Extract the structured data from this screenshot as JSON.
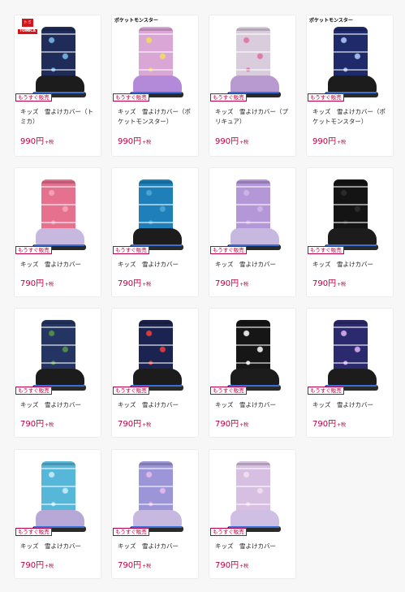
{
  "badge_label": "もうすぐ販売",
  "tax_suffix": "+税",
  "products": [
    {
      "name": "キッズ　雪よけカバー（トミカ）",
      "price": "990円",
      "color": "#1f2c5a",
      "pattern": "#6fa8dc",
      "brand": "トミカ / TOMICA",
      "boot": "#1c1c1c"
    },
    {
      "name": "キッズ　雪よけカバー（ポケットモンスター）",
      "price": "990円",
      "color": "#d9a6d6",
      "pattern": "#f2d66b",
      "brand": "ポケットモンスター",
      "boot": "#b28ad9"
    },
    {
      "name": "キッズ　雪よけカバー（プリキュア）",
      "price": "990円",
      "color": "#d9ccdc",
      "pattern": "#e07aa8",
      "brand": "",
      "boot": "#b89ad0"
    },
    {
      "name": "キッズ　雪よけカバー（ポケットモンスター）",
      "price": "990円",
      "color": "#1f2a6b",
      "pattern": "#9fb7e8",
      "brand": "ポケットモンスター",
      "boot": "#1c1c1c"
    },
    {
      "name": "キッズ　雪よけカバー",
      "price": "790円",
      "color": "#e5718f",
      "pattern": "#f4a0b4",
      "brand": "",
      "boot": "#c7b8e0"
    },
    {
      "name": "キッズ　雪よけカバー",
      "price": "790円",
      "color": "#1f7fb8",
      "pattern": "#4aa3d4",
      "brand": "",
      "boot": "#1c1c1c"
    },
    {
      "name": "キッズ　雪よけカバー",
      "price": "790円",
      "color": "#b497d6",
      "pattern": "#cbb3e6",
      "brand": "",
      "boot": "#c7b8e0"
    },
    {
      "name": "キッズ　雪よけカバー",
      "price": "790円",
      "color": "#141414",
      "pattern": "#2b2b2b",
      "brand": "",
      "boot": "#1c1c1c"
    },
    {
      "name": "キッズ　雪よけカバー",
      "price": "790円",
      "color": "#243563",
      "pattern": "#4f8a46",
      "brand": "",
      "boot": "#1c1c1c"
    },
    {
      "name": "キッズ　雪よけカバー",
      "price": "790円",
      "color": "#1b2450",
      "pattern": "#d83a3a",
      "brand": "",
      "boot": "#1c1c1c"
    },
    {
      "name": "キッズ　雪よけカバー",
      "price": "790円",
      "color": "#161616",
      "pattern": "#e0e0e0",
      "brand": "",
      "boot": "#1c1c1c"
    },
    {
      "name": "キッズ　雪よけカバー",
      "price": "790円",
      "color": "#2b2a6e",
      "pattern": "#c9a0e0",
      "brand": "",
      "boot": "#1c1c1c"
    },
    {
      "name": "キッズ　雪よけカバー",
      "price": "790円",
      "color": "#56b7d8",
      "pattern": "#bfe6f2",
      "brand": "",
      "boot": "#b8a8d8"
    },
    {
      "name": "キッズ　雪よけカバー",
      "price": "790円",
      "color": "#9c96d8",
      "pattern": "#e0b8e8",
      "brand": "",
      "boot": "#c7b8e0"
    },
    {
      "name": "キッズ　雪よけカバー",
      "price": "790円",
      "color": "#d6bfe0",
      "pattern": "#eedcf0",
      "brand": "",
      "boot": "#d0bfe4"
    }
  ],
  "colors": {
    "accent": "#c0003e",
    "background": "#f7f7f7",
    "card": "#ffffff"
  }
}
